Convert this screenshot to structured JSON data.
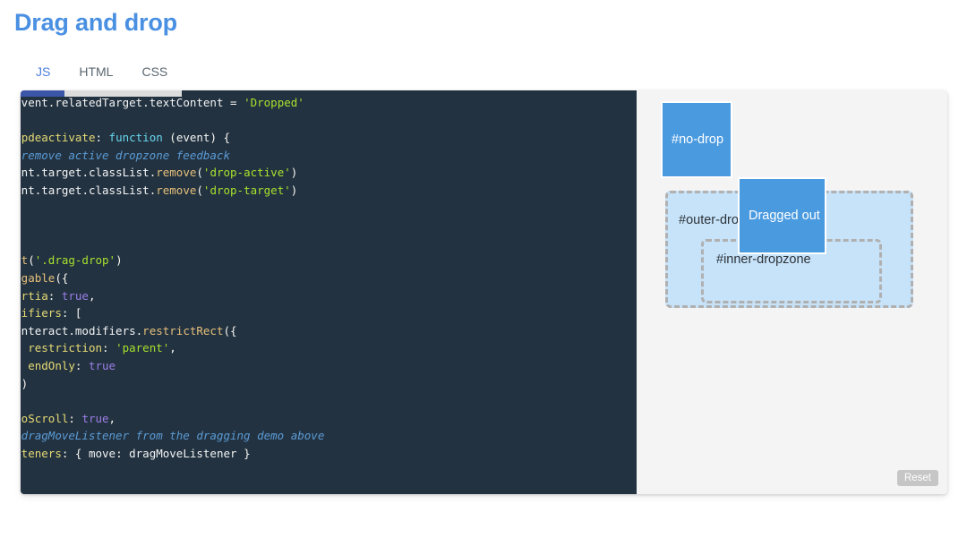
{
  "page": {
    "title": "Drag and drop"
  },
  "tabs": [
    {
      "id": "js",
      "label": "JS",
      "active": true
    },
    {
      "id": "html",
      "label": "HTML",
      "active": false
    },
    {
      "id": "css",
      "label": "CSS",
      "active": false
    }
  ],
  "code_pane": {
    "language": "JS",
    "scrollbar": {
      "orientation": "horizontal",
      "thumb_position_percent": 0,
      "thumb_width_percent": 27
    },
    "lines": [
      "      event.relatedTarget.textContent = 'Dropped'",
      "  },",
      "  ondropdeactivate: function (event) {",
      "    // remove active dropzone feedback",
      "    event.target.classList.remove('drop-active')",
      "    event.target.classList.remove('drop-target')",
      "  }",
      "})",
      "",
      "interact('.drag-drop')",
      "  .draggable({",
      "    inertia: true,",
      "    modifiers: [",
      "      interact.modifiers.restrictRect({",
      "        restriction: 'parent',",
      "        endOnly: true",
      "      })",
      "    ],",
      "    autoScroll: true,",
      "    // dragMoveListener from the dragging demo above",
      "    listeners: { move: dragMoveListener }",
      "  })"
    ]
  },
  "demo_pane": {
    "no_drop_box_label": "#no-drop",
    "drag_drop_box_label": "Dragged out",
    "outer_dropzone_label": "#outer-dropzone",
    "inner_dropzone_label": "#inner-dropzone",
    "reset_label": "Reset"
  },
  "colors": {
    "title_blue": "#4a90e2",
    "tab_active": "#4a7fe0",
    "tab_inactive": "#5b6770",
    "code_background": "#233240",
    "demo_background": "#f4f4f5",
    "drag_box_blue": "#4a9ae0",
    "dropzone_fill": "#c7e3fa",
    "dropzone_border": "#b0b0b0",
    "scrollbar_thumb": "#3b56a8",
    "scrollbar_track": "#dcdcdc",
    "reset_button": "#c6c6c6"
  }
}
